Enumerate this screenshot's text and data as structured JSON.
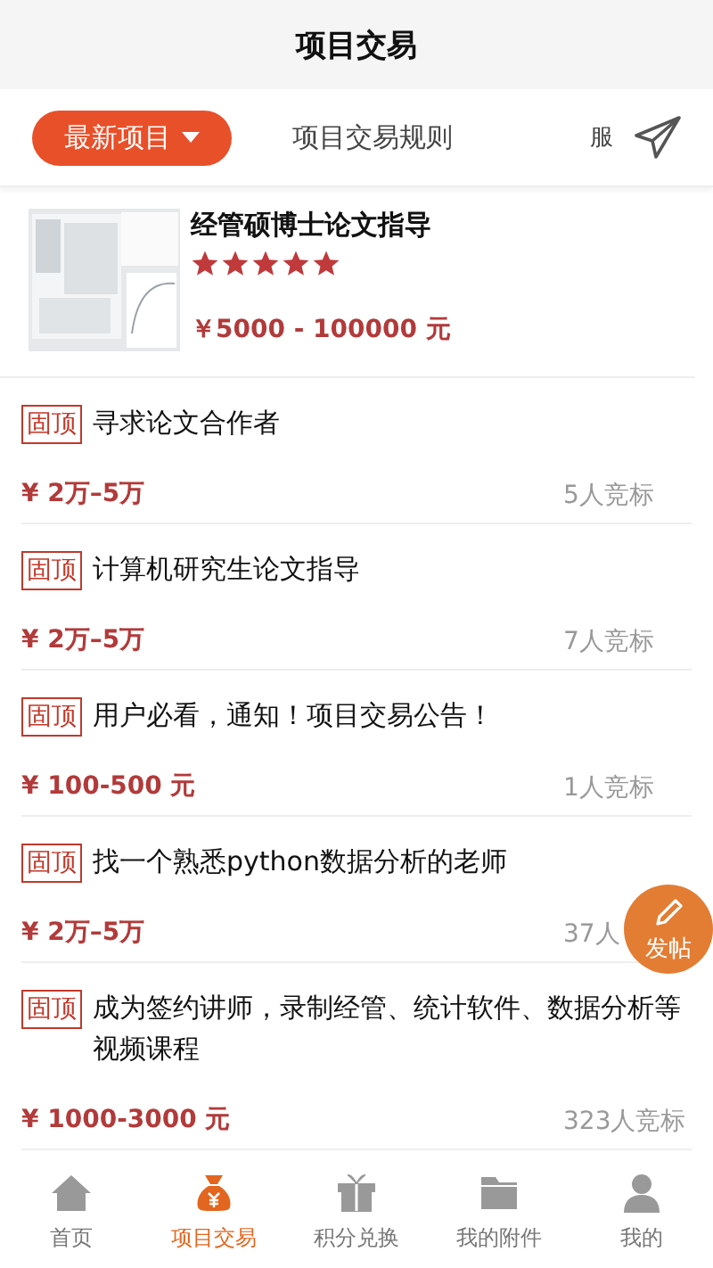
{
  "header": {
    "title": "项目交易"
  },
  "tabs": [
    {
      "label": "最新项目",
      "selected": true
    },
    {
      "label": "项目交易规则",
      "selected": false
    },
    {
      "label": "服",
      "selected": false
    }
  ],
  "featured": {
    "title": "经管硕博士论文指导",
    "stars": 5,
    "price": "￥5000 - 100000 元"
  },
  "projects": [
    {
      "badge": "固顶",
      "title": "寻求论文合作者",
      "price": "¥ 2万–5万",
      "count": "5人竞标"
    },
    {
      "badge": "固顶",
      "title": "计算机研究生论文指导",
      "price": "¥ 2万–5万",
      "count": "7人竞标"
    },
    {
      "badge": "固顶",
      "title": "用户必看，通知！项目交易公告！",
      "price": "¥ 100-500 元",
      "count": "1人竞标"
    },
    {
      "badge": "固顶",
      "title": "找一个熟悉python数据分析的老师",
      "price": "¥ 2万–5万",
      "count": "37人"
    },
    {
      "badge": "固顶",
      "title": "成为签约讲师，录制经管、统计软件、数据分析等视频课程",
      "price": "¥ 1000-3000 元",
      "count": "323人竞标"
    }
  ],
  "fab": {
    "label": "发帖"
  },
  "nav": [
    {
      "kind": "home",
      "label": "首页",
      "selected": false
    },
    {
      "kind": "bag",
      "label": "项目交易",
      "selected": true
    },
    {
      "kind": "gift",
      "label": "积分兑换",
      "selected": false
    },
    {
      "kind": "folder",
      "label": "我的附件",
      "selected": false
    },
    {
      "kind": "user",
      "label": "我的",
      "selected": false
    }
  ]
}
